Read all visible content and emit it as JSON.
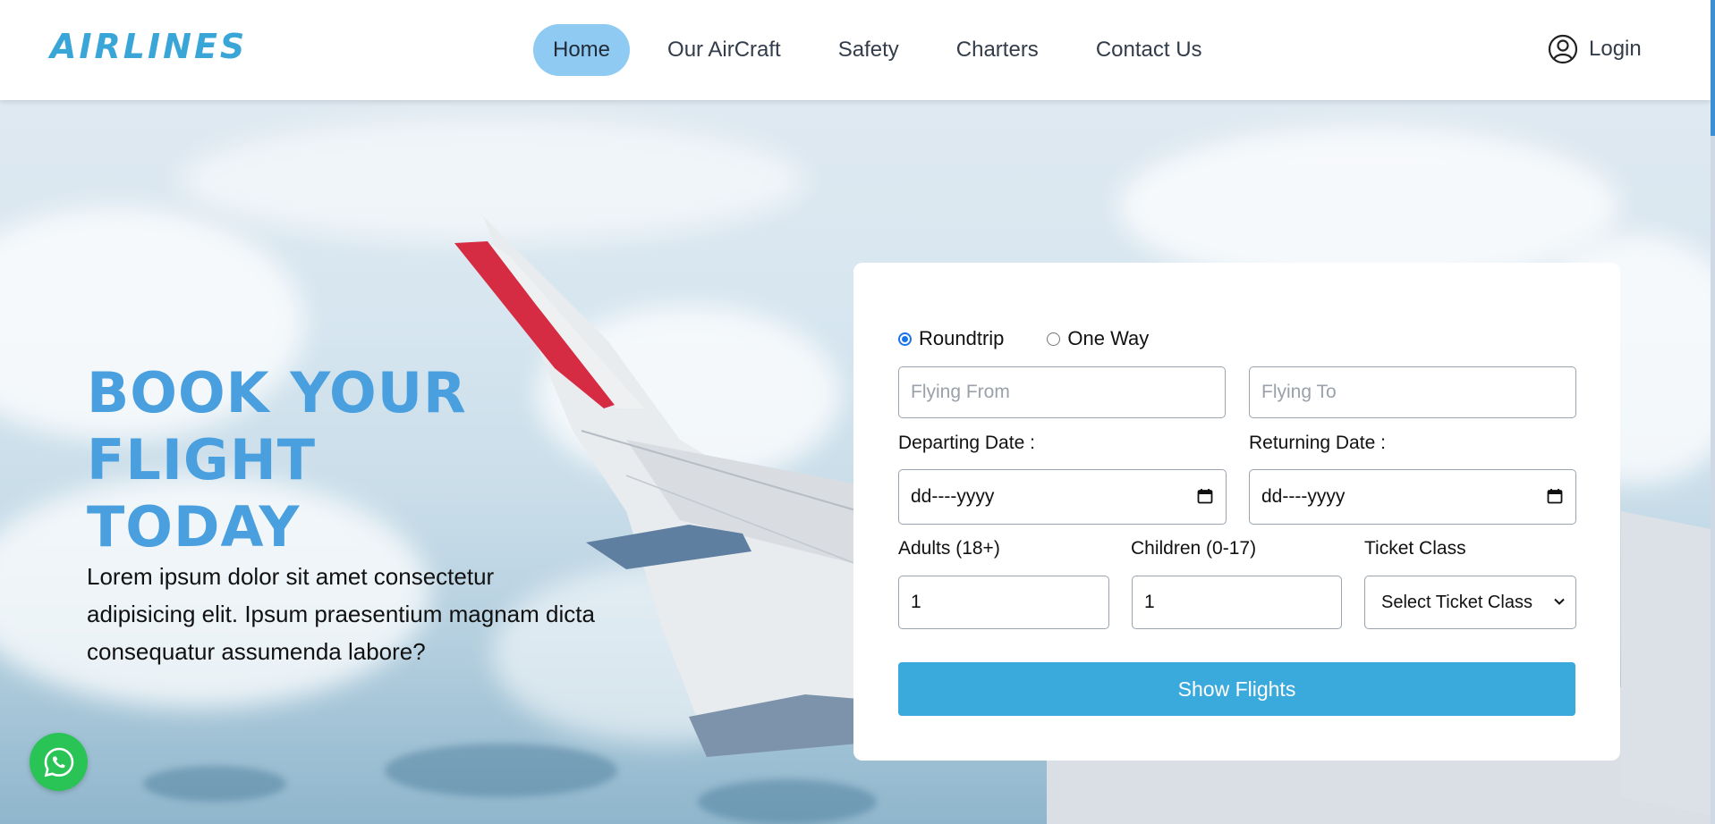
{
  "brand": {
    "logo_text": "AIRLINES",
    "accent_color": "#3aa6d8"
  },
  "nav": {
    "items": [
      {
        "label": "Home",
        "active": true
      },
      {
        "label": "Our AirCraft",
        "active": false
      },
      {
        "label": "Safety",
        "active": false
      },
      {
        "label": "Charters",
        "active": false
      },
      {
        "label": "Contact Us",
        "active": false
      }
    ],
    "login_label": "Login",
    "login_icon": "user-circle-icon"
  },
  "hero": {
    "title_lines": [
      "BOOK YOUR",
      "FLIGHT",
      "TODAY"
    ],
    "description": "Lorem ipsum dolor sit amet consectetur adipisicing elit. Ipsum praesentium magnam dicta consequatur assumenda labore?"
  },
  "booking": {
    "trip_types": [
      {
        "label": "Roundtrip",
        "checked": true
      },
      {
        "label": "One Way",
        "checked": false
      }
    ],
    "flying_from": {
      "placeholder": "Flying From",
      "value": ""
    },
    "flying_to": {
      "placeholder": "Flying To",
      "value": ""
    },
    "departing_date": {
      "label": "Departing Date :",
      "value": "dd----yyyy"
    },
    "returning_date": {
      "label": "Returning Date :",
      "value": "dd----yyyy"
    },
    "adults": {
      "label": "Adults (18+)",
      "value": "1"
    },
    "children": {
      "label": "Children (0-17)",
      "value": "1"
    },
    "ticket_class": {
      "label": "Ticket Class",
      "selected": "Select Ticket Class"
    },
    "submit_label": "Show Flights",
    "button_color": "#3aa9dc"
  },
  "floating": {
    "whatsapp_icon": "whatsapp-icon",
    "color": "#29c455"
  }
}
